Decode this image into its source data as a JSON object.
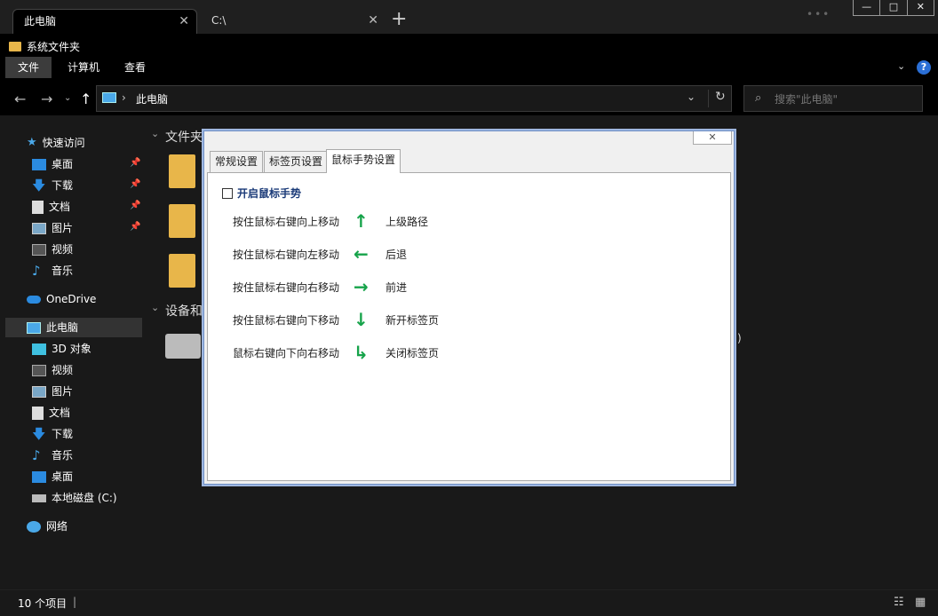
{
  "tabs": [
    {
      "label": "此电脑"
    },
    {
      "label": "C:\\"
    }
  ],
  "window": {
    "minimize": "—",
    "maximize": "□",
    "close": "✕"
  },
  "title": "系统文件夹",
  "ribbon": {
    "tabs": [
      "文件",
      "计算机",
      "查看"
    ]
  },
  "address": {
    "path": "此电脑"
  },
  "search": {
    "placeholder": "搜索\"此电脑\""
  },
  "sidebar": {
    "quick_access": "快速访问",
    "quick_items": [
      {
        "label": "桌面",
        "pinned": true
      },
      {
        "label": "下载",
        "pinned": true
      },
      {
        "label": "文档",
        "pinned": true
      },
      {
        "label": "图片",
        "pinned": true
      },
      {
        "label": "视频",
        "pinned": false
      },
      {
        "label": "音乐",
        "pinned": false
      }
    ],
    "onedrive": "OneDrive",
    "this_pc": "此电脑",
    "pc_items": [
      "3D 对象",
      "视频",
      "图片",
      "文档",
      "下载",
      "音乐",
      "桌面",
      "本地磁盘 (C:)"
    ],
    "network": "网络"
  },
  "content": {
    "group1": "文件夹",
    "group2": "设备和",
    "drive_tail": ":)"
  },
  "status": {
    "count": "10 个项目",
    "sep": "|"
  },
  "dialog": {
    "close": "✕",
    "tabs": [
      "常规设置",
      "标签页设置",
      "鼠标手势设置"
    ],
    "enable_label": "开启鼠标手势",
    "gestures": [
      {
        "action": "按住鼠标右键向上移动",
        "arrow": "↑",
        "result": "上级路径"
      },
      {
        "action": "按住鼠标右键向左移动",
        "arrow": "←",
        "result": "后退"
      },
      {
        "action": "按住鼠标右键向右移动",
        "arrow": "→",
        "result": "前进"
      },
      {
        "action": "按住鼠标右键向下移动",
        "arrow": "↓",
        "result": "新开标签页"
      },
      {
        "action": "鼠标右键向下向右移动",
        "arrow": "↳",
        "result": "关闭标签页"
      }
    ]
  }
}
